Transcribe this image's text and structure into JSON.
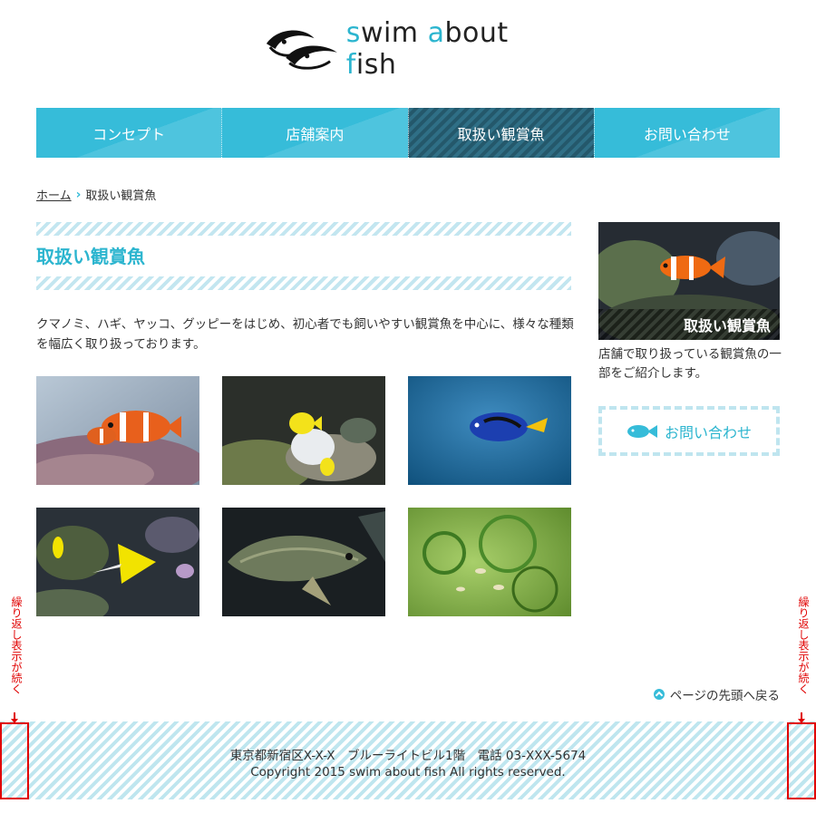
{
  "site": {
    "logo_text_parts": [
      "s",
      "wim ",
      "a",
      "bout ",
      "f",
      "ish"
    ]
  },
  "nav": {
    "items": [
      {
        "label": "コンセプト",
        "active": false
      },
      {
        "label": "店舗案内",
        "active": false
      },
      {
        "label": "取扱い観賞魚",
        "active": true
      },
      {
        "label": "お問い合わせ",
        "active": false
      }
    ]
  },
  "breadcrumb": {
    "home": "ホーム",
    "current": "取扱い観賞魚"
  },
  "main": {
    "title": "取扱い観賞魚",
    "intro": "クマノミ、ハギ、ヤッコ、グッピーをはじめ、初心者でも飼いやすい観賞魚を中心に、様々な種類を幅広く取り扱っております。",
    "gallery": [
      {
        "icon": "clownfish-photo"
      },
      {
        "icon": "yellow-tang-photo"
      },
      {
        "icon": "blue-tang-photo"
      },
      {
        "icon": "butterflyfish-photo"
      },
      {
        "icon": "arowana-photo"
      },
      {
        "icon": "guppies-photo"
      }
    ]
  },
  "sidebar": {
    "banner_caption": "取扱い観賞魚",
    "banner_text": "店舗で取り扱っている観賞魚の一部をご紹介します。",
    "contact_label": "お問い合わせ"
  },
  "to_top": {
    "label": "ページの先頭へ戻る"
  },
  "footer": {
    "address": "東京都新宿区X-X-X　ブルーライトビル1階　電話 03-XXX-5674",
    "copyright": "Copyright 2015 swim about fish All rights reserved."
  },
  "annotation": {
    "repeat_note": "繰り返し表示が続く"
  },
  "colors": {
    "accent": "#36bcd9",
    "nav_active": "#2f6f86",
    "annotation": "#e00000"
  }
}
